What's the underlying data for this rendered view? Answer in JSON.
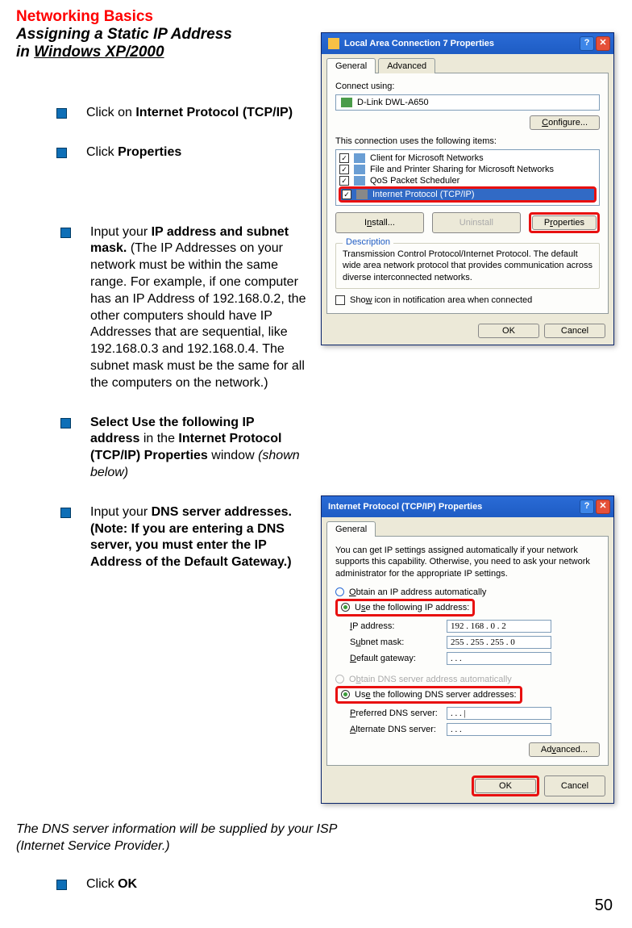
{
  "header": {
    "red_title": "Networking Basics",
    "italic_line1": "Assigning a Static IP Address",
    "italic_line2_prefix": "in ",
    "italic_line2_underline": "Windows XP/2000"
  },
  "bullets": [
    {
      "pre": "Click on ",
      "bold": "Internet Protocol (TCP/IP)",
      "post": ""
    },
    {
      "pre": "Click ",
      "bold": "Properties",
      "post": ""
    },
    {
      "pre": "Input your ",
      "bold": "IP address and subnet mask.",
      "post": " (The IP Addresses on your network must be within the same range. For example, if one computer has an IP Address of 192.168.0.2, the other computers should have IP Addresses that are sequential, like 192.168.0.3 and 192.168.0.4. The subnet mask must be the same for all the computers on the network.)"
    },
    {
      "bold_pre": "Select Use the following IP address",
      "mid": "  in the ",
      "bold2": "Internet Protocol (TCP/IP) Properties",
      "post_plain": " window ",
      "post_italic": "(shown below)"
    },
    {
      "pre": "Input your ",
      "bold": "DNS server addresses. (Note:  If you are entering a DNS server, you must enter the IP Address of the Default Gateway.)",
      "post": ""
    },
    {
      "pre": "Click ",
      "bold": "OK",
      "post": ""
    }
  ],
  "note": "The DNS server information will be supplied by your ISP (Internet Service Provider.)",
  "page_number": "50",
  "dialog1": {
    "title": "Local Area Connection 7 Properties",
    "help_btn": "?",
    "close_btn": "✕",
    "tabs": [
      "General",
      "Advanced"
    ],
    "connect_using_label": "Connect using:",
    "adapter": "D-Link DWL-A650",
    "configure_btn": "Configure...",
    "conn_uses_label": "This connection uses the following items:",
    "items": [
      "Client for Microsoft Networks",
      "File and Printer Sharing for Microsoft Networks",
      "QoS Packet Scheduler",
      "Internet Protocol (TCP/IP)"
    ],
    "install_btn": "Install...",
    "uninstall_btn": "Uninstall",
    "properties_btn": "Properties",
    "desc_label": "Description",
    "desc_text": "Transmission Control Protocol/Internet Protocol. The default wide area network protocol that provides communication across diverse interconnected networks.",
    "show_icon": "Show icon in notification area when connected",
    "ok_btn": "OK",
    "cancel_btn": "Cancel"
  },
  "dialog2": {
    "title": "Internet Protocol (TCP/IP) Properties",
    "help_btn": "?",
    "close_btn": "✕",
    "tab": "General",
    "intro": "You can get IP settings assigned automatically if your network supports this capability. Otherwise, you need to ask your network administrator for the appropriate IP settings.",
    "radio_auto_ip": "Obtain an IP address automatically",
    "radio_use_ip": "Use the following IP address:",
    "ip_label": "IP address:",
    "ip_value": "192 . 168 .  0  .   2",
    "subnet_label": "Subnet mask:",
    "subnet_value": "255 . 255 . 255 .  0",
    "gateway_label": "Default gateway:",
    "gateway_value": ".        .        .",
    "radio_auto_dns": "Obtain DNS server address automatically",
    "radio_use_dns": "Use the following DNS server addresses:",
    "pref_dns_label": "Preferred DNS server:",
    "pref_dns_value": ".        .        . |",
    "alt_dns_label": "Alternate DNS server:",
    "alt_dns_value": ".        .        .",
    "advanced_btn": "Advanced...",
    "ok_btn": "OK",
    "cancel_btn": "Cancel"
  }
}
